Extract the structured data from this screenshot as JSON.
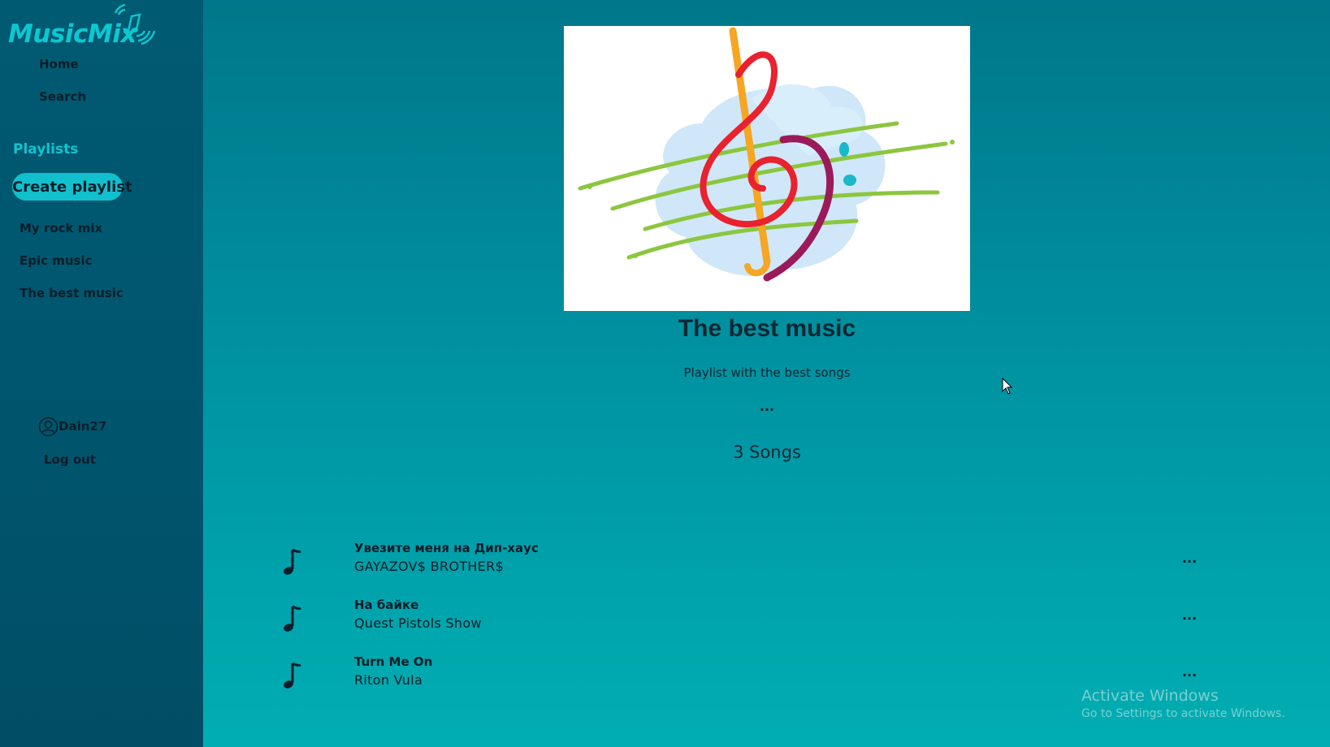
{
  "app": {
    "logo_text": "MusicMix"
  },
  "nav": {
    "home": "Home",
    "search": "Search"
  },
  "sidebar": {
    "playlists_heading": "Playlists",
    "create_button": "Create playlist",
    "playlists": [
      "My rock mix",
      "Epic music",
      "The best music"
    ]
  },
  "user": {
    "name": "Dain27",
    "logout": "Log out"
  },
  "playlist": {
    "title": "The best music",
    "description": "Playlist with the best songs",
    "more": "...",
    "song_count": "3 Songs"
  },
  "songs": [
    {
      "title": "Увезите меня на Дип-хаус",
      "artist": "GAYAZOV$ BROTHER$",
      "more": "..."
    },
    {
      "title": "На байке",
      "artist": "Quest Pistols Show",
      "more": "..."
    },
    {
      "title": "Turn Me On",
      "artist": "Riton  Vula",
      "more": "..."
    }
  ],
  "watermark": {
    "line1": "Activate Windows",
    "line2": "Go to Settings to activate Windows."
  },
  "colors": {
    "accent": "#12c0cd",
    "sidebar": "#00566e",
    "text": "#0d1e2a"
  }
}
